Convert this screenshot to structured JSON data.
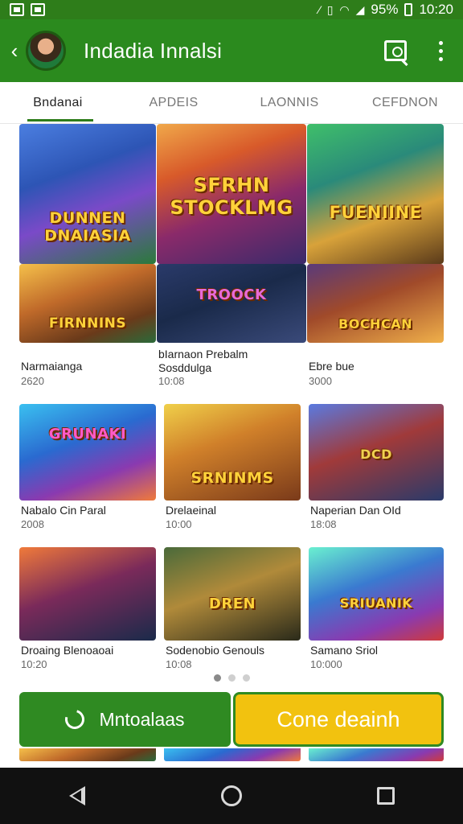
{
  "status_bar": {
    "battery_text": "95%",
    "time": "10:20"
  },
  "app_bar": {
    "title": "Indadia Innalsi"
  },
  "tabs": [
    {
      "label": "Bndanai",
      "active": true
    },
    {
      "label": "APDEIS",
      "active": false
    },
    {
      "label": "LAONNIS",
      "active": false
    },
    {
      "label": "CEFDNON",
      "active": false
    }
  ],
  "cards": [
    {
      "thumb_text": "DUNNEN DNAIASIA",
      "title": "Narmaianga",
      "meta": "2620"
    },
    {
      "thumb_text": "SFRHN STOCKLMG",
      "title": "",
      "meta": ""
    },
    {
      "thumb_text": "FUENIINE",
      "title": "",
      "meta": ""
    },
    {
      "thumb_text": "FIRNNINS",
      "title": "",
      "meta": ""
    },
    {
      "thumb_text": "TROOCK",
      "title": "bIarnaon Prebalm Sosddulga",
      "meta": "10:08"
    },
    {
      "thumb_text": "BOCHCAN",
      "title": "Ebre bue",
      "meta": "3000"
    },
    {
      "thumb_text": "GRUNAKI",
      "title": "Nabalo Cin Paral",
      "meta": "2008"
    },
    {
      "thumb_text": "SRNINMS",
      "title": "Drelaeinal",
      "meta": "10:00"
    },
    {
      "thumb_text": "DCD",
      "title": "Naperian Dan OId",
      "meta": "18:08"
    },
    {
      "thumb_text": "",
      "title": "Droaing Blenoaoai",
      "meta": "10:20"
    },
    {
      "thumb_text": "DREN",
      "title": "Sodenobio Genouls",
      "meta": "10:08"
    },
    {
      "thumb_text": "SRIUANIK",
      "title": "Samano Sriol",
      "meta": "10:000"
    }
  ],
  "pager": {
    "count": 3,
    "active_index": 0
  },
  "actions": {
    "primary_label": "Mntoalaas",
    "secondary_label": "Cone deainh"
  },
  "colors": {
    "brand_green": "#2b8a1e",
    "accent_yellow": "#f2c20f",
    "nav_bar": "#111111"
  },
  "icons": [
    "back-arrow-icon",
    "avatar",
    "search-icon",
    "more-vert-icon",
    "phone-icon",
    "nav-back-icon",
    "nav-home-icon",
    "nav-recents-icon"
  ]
}
